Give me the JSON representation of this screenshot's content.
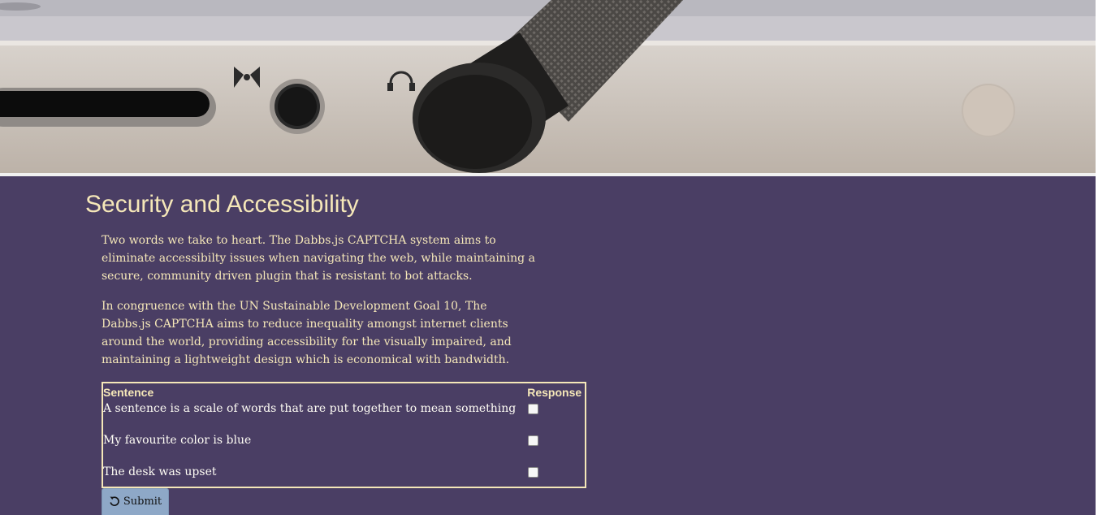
{
  "hero": {
    "alt": "Close-up photo of a laptop side with ports and a stylus"
  },
  "section": {
    "title": "Security and Accessibility",
    "paragraphs": [
      "Two words we take to heart. The Dabbs.js CAPTCHA system aims to eliminate accessibilty issues when navigating the web, while maintaining a secure, community driven plugin that is resistant to bot attacks.",
      "In congruence with the UN Sustainable Development Goal 10, The Dabbs.js CAPTCHA aims to reduce inequality amongst internet clients around the world, providing accessibility for the visually impaired, and maintaining a lightweight design which is economical with bandwidth."
    ]
  },
  "table": {
    "headers": [
      "Sentence",
      "Response"
    ],
    "rows": [
      {
        "sentence": "A sentence is a scale of words that are put together to mean something",
        "checked": false
      },
      {
        "sentence": "My favourite color is blue",
        "checked": false
      },
      {
        "sentence": "The desk was upset",
        "checked": false
      }
    ]
  },
  "submit": {
    "label": "Submit",
    "icon": "refresh-icon"
  },
  "colors": {
    "background": "#4a3e64",
    "accent_text": "#f5e7b8",
    "button": "#8ea8c7"
  }
}
